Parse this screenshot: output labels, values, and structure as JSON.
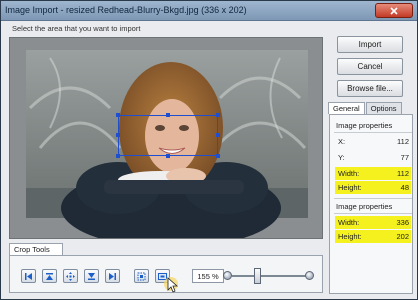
{
  "window": {
    "title": "Image Import - resized Redhead-Blurry-Bkgd.jpg  (336 x 202)",
    "close_icon": "close-icon"
  },
  "instruction": "Select the area that you want to import",
  "buttons": {
    "import": "Import",
    "cancel": "Cancel",
    "browse": "Browse file..."
  },
  "tabs": [
    {
      "label": "General",
      "active": true
    },
    {
      "label": "Options",
      "active": false
    }
  ],
  "selection": {
    "group_title": "Image properties",
    "x_label": "X:",
    "x": "112",
    "y_label": "Y:",
    "y": "77",
    "width_label": "Width:",
    "width": "112",
    "height_label": "Height:",
    "height": "48"
  },
  "image": {
    "group_title": "Image properties",
    "width_label": "Width:",
    "width": "336",
    "height_label": "Height:",
    "height": "202"
  },
  "crop_tools": {
    "tab_label": "Crop Tools",
    "buttons": [
      "first-icon",
      "align-top-icon",
      "move-center-icon",
      "align-bottom-icon",
      "last-icon",
      "fit-selection-icon",
      "crop-select-icon"
    ],
    "zoom": "155 %"
  },
  "colors": {
    "highlight": "#f4f11e",
    "selection": "#1e4fd0",
    "titlebar": "#8ea6c2"
  }
}
